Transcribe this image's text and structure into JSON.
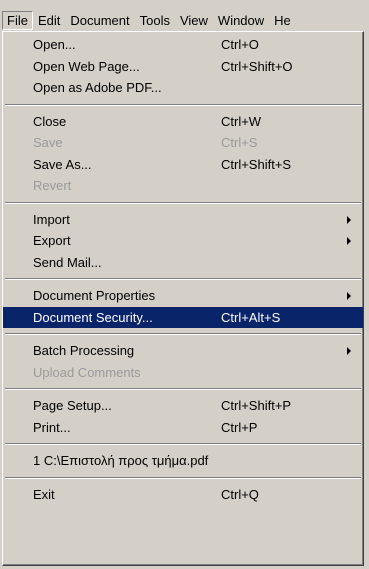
{
  "menubar": {
    "items": [
      "File",
      "Edit",
      "Document",
      "Tools",
      "View",
      "Window",
      "He"
    ]
  },
  "menu": {
    "groups": [
      [
        {
          "label": "Open...",
          "shortcut": "Ctrl+O"
        },
        {
          "label": "Open Web Page...",
          "shortcut": "Ctrl+Shift+O"
        },
        {
          "label": "Open as Adobe PDF..."
        }
      ],
      [
        {
          "label": "Close",
          "shortcut": "Ctrl+W"
        },
        {
          "label": "Save",
          "shortcut": "Ctrl+S",
          "disabled": true
        },
        {
          "label": "Save As...",
          "shortcut": "Ctrl+Shift+S"
        },
        {
          "label": "Revert",
          "disabled": true
        }
      ],
      [
        {
          "label": "Import",
          "submenu": true
        },
        {
          "label": "Export",
          "submenu": true
        },
        {
          "label": "Send Mail..."
        }
      ],
      [
        {
          "label": "Document Properties",
          "submenu": true
        },
        {
          "label": "Document Security...",
          "shortcut": "Ctrl+Alt+S",
          "highlighted": true
        }
      ],
      [
        {
          "label": "Batch Processing",
          "submenu": true
        },
        {
          "label": "Upload Comments",
          "disabled": true
        }
      ],
      [
        {
          "label": "Page Setup...",
          "shortcut": "Ctrl+Shift+P"
        },
        {
          "label": "Print...",
          "shortcut": "Ctrl+P"
        }
      ],
      [
        {
          "label": "1 C:\\Επιστολή προς τμήμα.pdf"
        }
      ],
      [
        {
          "label": "Exit",
          "shortcut": "Ctrl+Q"
        }
      ]
    ]
  }
}
